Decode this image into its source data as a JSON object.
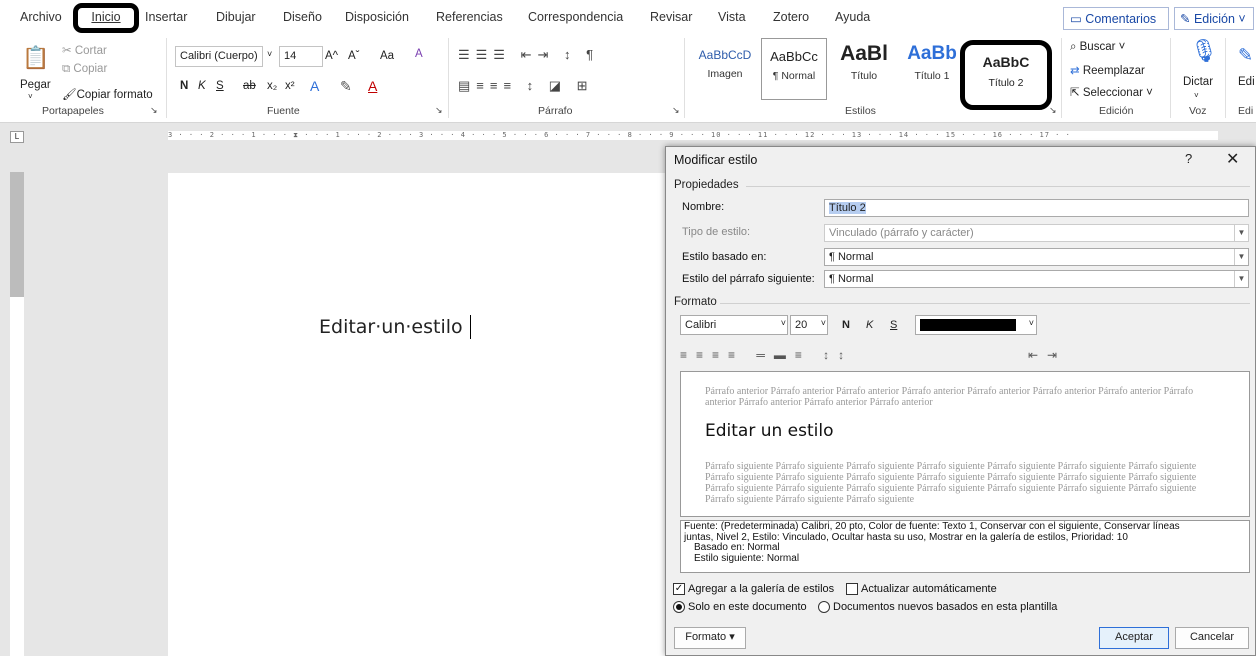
{
  "menu": {
    "tabs": [
      "Archivo",
      "Inicio",
      "Insertar",
      "Dibujar",
      "Diseño",
      "Disposición",
      "Referencias",
      "Correspondencia",
      "Revisar",
      "Vista",
      "Zotero",
      "Ayuda"
    ],
    "comments": "Comentarios",
    "editing": "Edición"
  },
  "ribbon": {
    "clipboard": {
      "paste": "Pegar",
      "cut": "Cortar",
      "copy": "Copiar",
      "format_painter": "Copiar formato",
      "group": "Portapapeles"
    },
    "font": {
      "name": "Calibri (Cuerpo)",
      "size": "14",
      "bold": "N",
      "italic": "K",
      "underline": "S",
      "strike": "ab",
      "sub": "x₂",
      "sup": "x²",
      "grow": "A^",
      "shrink": "Aˇ",
      "case": "Aa",
      "clear": "A",
      "group": "Fuente"
    },
    "paragraph": {
      "group": "Párrafo"
    },
    "styles": {
      "items": [
        {
          "preview": "AaBbCcD",
          "name": "Imagen"
        },
        {
          "preview": "AaBbCc",
          "name": "¶ Normal"
        },
        {
          "preview": "AaBl",
          "name": "Título"
        },
        {
          "preview": "AaBb",
          "name": "Título 1"
        },
        {
          "preview": "AaBbC",
          "name": "Título 2"
        }
      ],
      "group": "Estilos"
    },
    "editing": {
      "find": "Buscar",
      "replace": "Reemplazar",
      "select": "Seleccionar",
      "group": "Edición"
    },
    "voice": {
      "dictate": "Dictar",
      "group": "Voz"
    },
    "edit_cut": {
      "label": "Edi",
      "group": "Edi"
    }
  },
  "ruler": {
    "marks": "3 · · · 2 · · · 1 · · · ⧗ · · · 1 · · · 2 · · · 3 · · · 4 · · · 5 · · · 6 · · · 7 · · · 8 · · · 9 · · · 10 · · · 11 · · · 12 · · · 13 · · · 14 · · · 15 · · · 16 · · · 17 · ·"
  },
  "document": {
    "text": "Editar·un·estilo"
  },
  "dialog": {
    "title": "Modificar estilo",
    "help": "?",
    "close": "✕",
    "properties_group": "Propiedades",
    "name_label": "Nombre:",
    "name_value": "Título 2",
    "type_label": "Tipo de estilo:",
    "type_value": "Vinculado (párrafo y carácter)",
    "based_label": "Estilo basado en:",
    "based_value": "¶ Normal",
    "next_label": "Estilo del párrafo siguiente:",
    "next_value": "¶ Normal",
    "format_group": "Formato",
    "font": "Calibri",
    "size": "20",
    "bold": "N",
    "italic": "K",
    "underline": "S",
    "preview": {
      "prev": "Párrafo anterior Párrafo anterior Párrafo anterior Párrafo anterior Párrafo anterior Párrafo anterior Párrafo anterior Párrafo anterior Párrafo anterior Párrafo anterior Párrafo anterior",
      "sample": "Editar un estilo",
      "next": "Párrafo siguiente Párrafo siguiente Párrafo siguiente Párrafo siguiente Párrafo siguiente Párrafo siguiente Párrafo siguiente Párrafo siguiente Párrafo siguiente Párrafo siguiente Párrafo siguiente Párrafo siguiente Párrafo siguiente Párrafo siguiente Párrafo siguiente Párrafo siguiente Párrafo siguiente Párrafo siguiente Párrafo siguiente Párrafo siguiente Párrafo siguiente Párrafo siguiente Párrafo siguiente Párrafo siguiente"
    },
    "description": {
      "line1": "Fuente: (Predeterminada) Calibri, 20 pto, Color de fuente: Texto 1, Conservar con el siguiente, Conservar líneas",
      "line2": "juntas, Nivel 2, Estilo: Vinculado, Ocultar hasta su uso, Mostrar en la galería de estilos, Prioridad: 10",
      "line3": "Basado en: Normal",
      "line4": "Estilo siguiente: Normal"
    },
    "add_gallery": "Agregar a la galería de estilos",
    "auto_update": "Actualizar automáticamente",
    "only_doc": "Solo en este documento",
    "new_docs": "Documentos nuevos basados en esta plantilla",
    "format_btn": "Formato ▾",
    "accept": "Aceptar",
    "cancel": "Cancelar"
  }
}
